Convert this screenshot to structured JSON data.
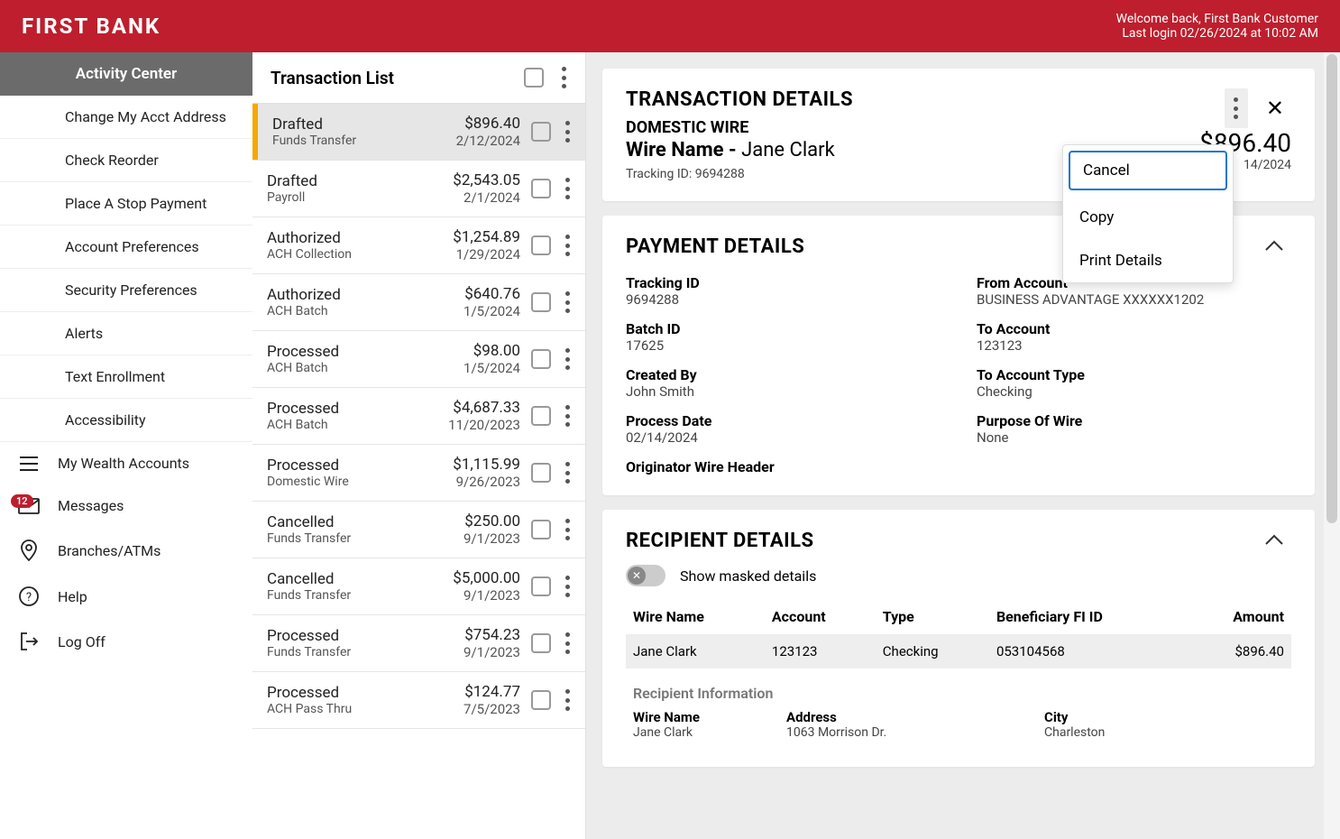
{
  "header": {
    "logo": "FIRST BANK",
    "welcome": "Welcome back, First Bank Customer",
    "last_login": "Last login 02/26/2024 at 10:02 AM"
  },
  "sidebar": {
    "title": "Activity Center",
    "items": [
      "Change My Acct Address",
      "Check Reorder",
      "Place A Stop Payment",
      "Account Preferences",
      "Security Preferences",
      "Alerts",
      "Text Enrollment",
      "Accessibility"
    ],
    "icon_items": [
      {
        "label": "My Wealth Accounts",
        "icon": "menu"
      },
      {
        "label": "Messages",
        "icon": "mail",
        "badge": "12"
      },
      {
        "label": "Branches/ATMs",
        "icon": "pin"
      },
      {
        "label": "Help",
        "icon": "help"
      },
      {
        "label": "Log Off",
        "icon": "logout"
      }
    ]
  },
  "txn_list": {
    "title": "Transaction List",
    "rows": [
      {
        "status": "Drafted",
        "type": "Funds Transfer",
        "amount": "$896.40",
        "date": "2/12/2024",
        "selected": true
      },
      {
        "status": "Drafted",
        "type": "Payroll",
        "amount": "$2,543.05",
        "date": "2/1/2024"
      },
      {
        "status": "Authorized",
        "type": "ACH Collection",
        "amount": "$1,254.89",
        "date": "1/29/2024"
      },
      {
        "status": "Authorized",
        "type": "ACH Batch",
        "amount": "$640.76",
        "date": "1/5/2024"
      },
      {
        "status": "Processed",
        "type": "ACH Batch",
        "amount": "$98.00",
        "date": "1/5/2024"
      },
      {
        "status": "Processed",
        "type": "ACH Batch",
        "amount": "$4,687.33",
        "date": "11/20/2023"
      },
      {
        "status": "Processed",
        "type": "Domestic Wire",
        "amount": "$1,115.99",
        "date": "9/26/2023"
      },
      {
        "status": "Cancelled",
        "type": "Funds Transfer",
        "amount": "$250.00",
        "date": "9/1/2023"
      },
      {
        "status": "Cancelled",
        "type": "Funds Transfer",
        "amount": "$5,000.00",
        "date": "9/1/2023"
      },
      {
        "status": "Processed",
        "type": "Funds Transfer",
        "amount": "$754.23",
        "date": "9/1/2023"
      },
      {
        "status": "Processed",
        "type": "ACH Pass Thru",
        "amount": "$124.77",
        "date": "7/5/2023"
      }
    ]
  },
  "details": {
    "title": "TRANSACTION DETAILS",
    "subtype": "DOMESTIC WIRE",
    "wire_label": "Wire Name -",
    "wire_value": "Jane Clark",
    "tracking_label": "Tracking ID:",
    "tracking_value": "9694288",
    "amount": "$896.4",
    "amount_truncated": "0",
    "process_date": "14/2024",
    "dropdown": [
      "Cancel",
      "Copy",
      "Print Details"
    ]
  },
  "payment": {
    "title": "PAYMENT DETAILS",
    "fields": [
      {
        "label": "Tracking ID",
        "value": "9694288"
      },
      {
        "label": "From Account",
        "value": "BUSINESS ADVANTAGE XXXXXX1202"
      },
      {
        "label": "Batch ID",
        "value": "17625"
      },
      {
        "label": "To Account",
        "value": "123123"
      },
      {
        "label": "Created By",
        "value": "John Smith"
      },
      {
        "label": "To Account Type",
        "value": "Checking"
      },
      {
        "label": "Process Date",
        "value": "02/14/2024"
      },
      {
        "label": "Purpose Of Wire",
        "value": "None"
      },
      {
        "label": "Originator Wire Header",
        "value": ""
      }
    ]
  },
  "recipient": {
    "title": "RECIPIENT DETAILS",
    "toggle_label": "Show masked details",
    "table": {
      "headers": [
        "Wire Name",
        "Account",
        "Type",
        "Beneficiary FI ID",
        "Amount"
      ],
      "row": [
        "Jane Clark",
        "123123",
        "Checking",
        "053104568",
        "$896.40"
      ]
    },
    "info_title": "Recipient Information",
    "info": [
      {
        "label": "Wire Name",
        "value": "Jane Clark"
      },
      {
        "label": "Address",
        "value": "1063 Morrison Dr."
      },
      {
        "label": "City",
        "value": "Charleston"
      }
    ]
  }
}
